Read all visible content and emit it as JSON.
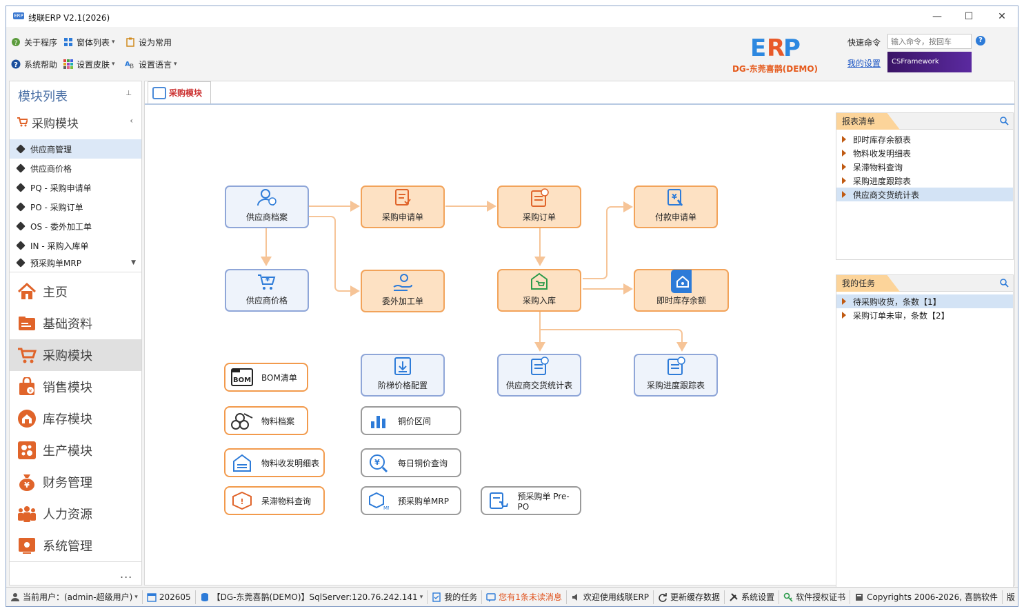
{
  "window": {
    "title": "线联ERP V2.1(2026)"
  },
  "toolbar": {
    "about": "关于程序",
    "windows": "窗体列表",
    "set_common": "设为常用",
    "help": "系统帮助",
    "skin": "设置皮肤",
    "language": "设置语言"
  },
  "brand": {
    "sub": "DG-东莞喜鹊(DEMO)",
    "csf": "CSFramework"
  },
  "quick": {
    "label": "快速命令",
    "placeholder": "输入命令，按回车",
    "my_settings": "我的设置"
  },
  "sidebar": {
    "title": "模块列表",
    "group": "采购模块",
    "subitems": [
      "供应商管理",
      "供应商价格",
      "PQ - 采购申请单",
      "PO - 采购订单",
      "OS - 委外加工单",
      "IN - 采购入库单",
      "预采购单MRP"
    ],
    "modules": [
      "主页",
      "基础资料",
      "采购模块",
      "销售模块",
      "库存模块",
      "生产模块",
      "财务管理",
      "人力资源",
      "系统管理"
    ],
    "more": "..."
  },
  "tab": {
    "label": "采购模块"
  },
  "flow": {
    "supplier_file": "供应商档案",
    "purchase_request": "采购申请单",
    "purchase_order": "采购订单",
    "payment_request": "付款申请单",
    "supplier_price": "供应商价格",
    "outsource_order": "委外加工单",
    "purchase_inbound": "采购入库",
    "instant_inventory": "即时库存余额",
    "tier_price": "阶梯价格配置",
    "supplier_delivery": "供应商交货统计表",
    "purchase_progress": "采购进度跟踪表"
  },
  "shortcuts": {
    "bom": "BOM清单",
    "material_file": "物料档案",
    "material_io": "物料收发明细表",
    "stale_material": "呆滞物料查询",
    "copper_range": "铜价区间",
    "daily_copper": "每日铜价查询",
    "pre_mrp": "预采购单MRP",
    "pre_po": "预采购单 Pre-PO"
  },
  "reports": {
    "title": "报表清单",
    "items": [
      "即时库存余额表",
      "物料收发明细表",
      "呆滞物料查询",
      "采购进度跟踪表",
      "供应商交货统计表"
    ]
  },
  "tasks": {
    "title": "我的任务",
    "items": [
      "待采购收货，条数【1】",
      "采购订单未审，条数【2】"
    ]
  },
  "status": {
    "user": "当前用户：(admin-超级用户)",
    "period": "202605",
    "db": "【DG-东莞喜鹊(DEMO)】SqlServer:120.76.242.141",
    "tasks": "我的任务",
    "unread": "您有1条未读消息",
    "welcome": "欢迎使用线联ERP",
    "refresh": "更新缓存数据",
    "settings": "系统设置",
    "license": "软件授权证书",
    "copyright": "Copyrights 2006-2026, 喜鹊软件",
    "version": "版"
  },
  "colors": {
    "accent": "#f29a4c",
    "blue_node": "#8fa6d8",
    "link": "#1b55c4"
  }
}
